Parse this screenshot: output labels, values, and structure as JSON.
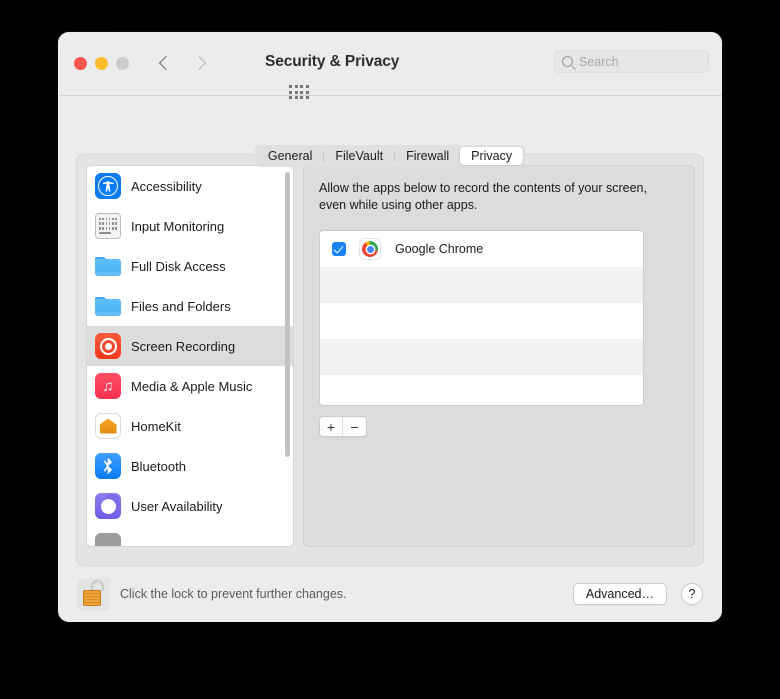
{
  "window": {
    "title": "Security & Privacy",
    "traffic_lights": [
      {
        "name": "close",
        "color": "#f9564f"
      },
      {
        "name": "minimize",
        "color": "#fbbd2e"
      },
      {
        "name": "zoom",
        "color": "#cccccc"
      }
    ],
    "nav": {
      "back": "‹",
      "forward": "›"
    },
    "grid_button": "show-all-icon"
  },
  "search": {
    "placeholder": "Search",
    "value": "",
    "icon": "search-icon"
  },
  "tabs": [
    {
      "label": "General",
      "selected": false
    },
    {
      "label": "FileVault",
      "selected": false
    },
    {
      "label": "Firewall",
      "selected": false
    },
    {
      "label": "Privacy",
      "selected": true
    }
  ],
  "sidebar": {
    "items": [
      {
        "label": "Accessibility",
        "icon": "accessibility-icon",
        "selected": false
      },
      {
        "label": "Input Monitoring",
        "icon": "keyboard-icon",
        "selected": false
      },
      {
        "label": "Full Disk Access",
        "icon": "folder-icon",
        "selected": false
      },
      {
        "label": "Files and Folders",
        "icon": "folder-icon",
        "selected": false
      },
      {
        "label": "Screen Recording",
        "icon": "screen-recording-icon",
        "selected": true
      },
      {
        "label": "Media & Apple Music",
        "icon": "music-icon",
        "selected": false
      },
      {
        "label": "HomeKit",
        "icon": "homekit-icon",
        "selected": false
      },
      {
        "label": "Bluetooth",
        "icon": "bluetooth-icon",
        "selected": false
      },
      {
        "label": "User Availability",
        "icon": "moon-icon",
        "selected": false
      }
    ]
  },
  "pane": {
    "description": "Allow the apps below to record the contents of your screen, even while using other apps.",
    "apps": [
      {
        "name": "Google Chrome",
        "checked": true,
        "icon": "chrome-icon"
      }
    ],
    "add_label": "+",
    "remove_label": "−"
  },
  "footer": {
    "lock_icon": "unlocked-padlock-icon",
    "lock_text": "Click the lock to prevent further changes.",
    "advanced_label": "Advanced…",
    "help_label": "?"
  },
  "colors": {
    "accent": "#1a84f5",
    "selected_row": "#dcdcdc",
    "window_bg": "#ececec",
    "panel_bg": "#e4e4e4"
  }
}
